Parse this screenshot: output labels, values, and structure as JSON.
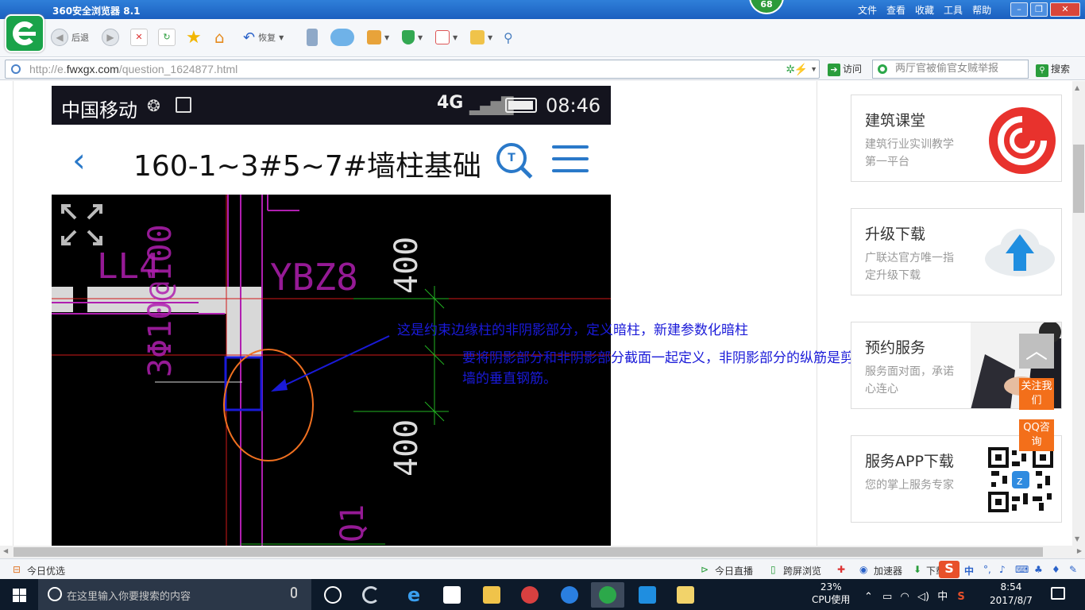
{
  "browser": {
    "app_title": "360安全浏览器 8.1",
    "badge": "68",
    "menus": [
      "文件",
      "查看",
      "收藏",
      "工具",
      "帮助"
    ],
    "toolbar": {
      "back_label": "后退",
      "restore_label": "恢复"
    },
    "address": {
      "prefix": "http://e.",
      "domain": "fwxgx.com",
      "path": "/question_1624877.html"
    },
    "visit_label": "访问",
    "search": {
      "placeholder": "两厅官被偷官女贼举报",
      "button": "搜索"
    }
  },
  "phone": {
    "carrier": "中国移动",
    "signal": "4G",
    "time": "08:46",
    "page_title": "160-1~3#5~7#墙柱基础"
  },
  "cad": {
    "labels": [
      "LL4",
      "3Φ10@100",
      "YBZ8",
      "400",
      "400",
      "Q1"
    ],
    "note1": "这是约束边缘柱的非阴影部分，定义暗柱，新建参数化暗柱",
    "note2": "要将阴影部分和非阴影部分截面一起定义，非阴影部分的纵筋是剪力墙的垂直钢筋。"
  },
  "sidebar": {
    "cards": [
      {
        "title": "建筑课堂",
        "subtitle": "建筑行业实训教学第一平台"
      },
      {
        "title": "升级下载",
        "subtitle": "广联达官方唯一指定升级下载"
      },
      {
        "title": "预约服务",
        "subtitle": "服务面对面，承诺心连心"
      },
      {
        "title": "服务APP下载",
        "subtitle": "您的掌上服务专家"
      }
    ],
    "float_buttons": [
      {
        "label": "关注我们"
      },
      {
        "label": "QQ咨询"
      }
    ]
  },
  "statusbar": {
    "left": "今日优选",
    "live": "今日直播",
    "cross_screen": "跨屏浏览",
    "accelerator": "加速器",
    "download": "下载",
    "ime": "中"
  },
  "taskbar": {
    "search_placeholder": "在这里输入你要搜索的内容",
    "cpu_percent": "23%",
    "cpu_label": "CPU使用",
    "ime": "中",
    "time": "8:54",
    "date": "2017/8/7"
  },
  "colors": {
    "cad_background": "#000000",
    "annotation_blue": "#1a1ad8",
    "accent_blue": "#2a79c9",
    "float_orange": "#f36f1a"
  }
}
